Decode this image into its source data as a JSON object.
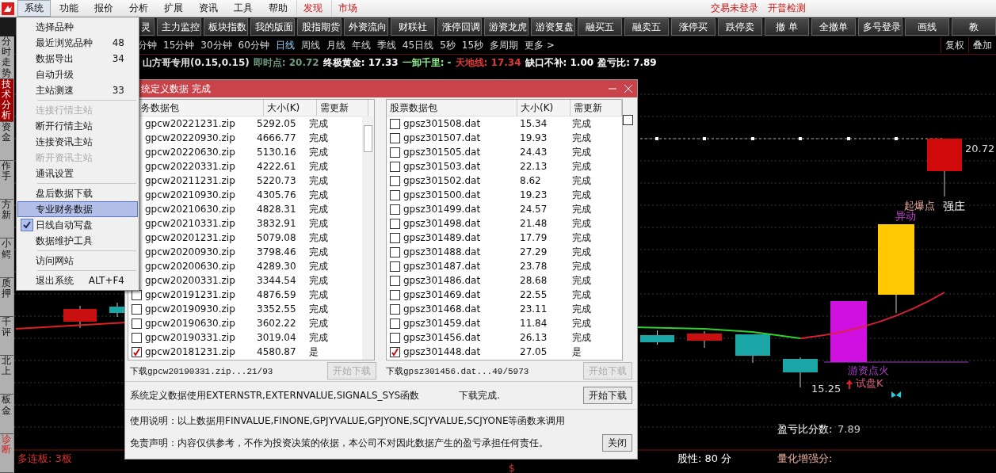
{
  "menubar": {
    "items": [
      {
        "label": "系统",
        "selected": true
      },
      {
        "label": "功能",
        "selected": false
      },
      {
        "label": "报价",
        "selected": false
      },
      {
        "label": "分析",
        "selected": false
      },
      {
        "label": "扩展",
        "selected": false
      },
      {
        "label": "资讯",
        "selected": false
      },
      {
        "label": "工具",
        "selected": false
      },
      {
        "label": "帮助",
        "selected": false
      }
    ],
    "highlights": [
      "发现",
      "市场"
    ],
    "status": [
      "交易未登录",
      "开普检测"
    ]
  },
  "toolbar": {
    "buttons": [
      "灵",
      "主力监控",
      "板块指数",
      "我的版面",
      "股指期货",
      "外资流向",
      "财联社",
      "涨停回调",
      "游资龙虎",
      "游资复盘",
      "融买五",
      "融卖五",
      "涨停买",
      "跌停卖",
      "撤 单",
      "全撤单",
      "多号登录",
      "画线",
      "教"
    ]
  },
  "side_tabs": [
    {
      "label": "分时走势",
      "selected": false,
      "kind": "normal"
    },
    {
      "label": "技术分析",
      "selected": true,
      "kind": "normal"
    },
    {
      "label": "资金",
      "selected": false,
      "kind": "normal"
    },
    {
      "label": "作手",
      "selected": false,
      "kind": "normal"
    },
    {
      "label": "方新",
      "selected": false,
      "kind": "normal"
    },
    {
      "label": "小鳄",
      "selected": false,
      "kind": "normal"
    },
    {
      "label": "质押",
      "selected": false,
      "kind": "normal"
    },
    {
      "label": "千评",
      "selected": false,
      "kind": "normal"
    },
    {
      "label": "北上",
      "selected": false,
      "kind": "normal"
    },
    {
      "label": "板金",
      "selected": false,
      "kind": "normal"
    },
    {
      "label": "诊断",
      "selected": false,
      "kind": "alert"
    }
  ],
  "periods": {
    "items": [
      {
        "label": "分钟",
        "selected": false
      },
      {
        "label": "15分钟",
        "selected": false
      },
      {
        "label": "30分钟",
        "selected": false
      },
      {
        "label": "60分钟",
        "selected": false
      },
      {
        "label": "日线",
        "selected": true
      },
      {
        "label": "周线",
        "selected": false
      },
      {
        "label": "月线",
        "selected": false
      },
      {
        "label": "年线",
        "selected": false
      },
      {
        "label": "季线",
        "selected": false
      },
      {
        "label": "45日线",
        "selected": false
      },
      {
        "label": "5秒",
        "selected": false
      },
      {
        "label": "15秒",
        "selected": false
      },
      {
        "label": "多周期",
        "selected": false
      },
      {
        "label": "更多 >",
        "selected": false
      }
    ],
    "right_buttons": [
      "复权",
      "叠加"
    ]
  },
  "indicator_line": [
    {
      "text": "山方哥专用(0.15,0.15)",
      "color": "#e6e6e6"
    },
    {
      "text": "即时点: 20.72",
      "color": "#6f9a80"
    },
    {
      "text": "终极黄金: 17.33",
      "color": "#ffffff"
    },
    {
      "text": "一卸千里: -",
      "color": "#90ee90"
    },
    {
      "text": "天地线: 17.34",
      "color": "#e03a3a"
    },
    {
      "text": "缺口不补: 1.00",
      "color": "#ffffff"
    },
    {
      "text": "盈亏比: 7.89",
      "color": "#ffffff"
    }
  ],
  "system_menu": {
    "groups": [
      [
        {
          "label": "选择品种",
          "disabled": false,
          "checked": false,
          "selected": false
        },
        {
          "label": "最近浏览品种",
          "shortcut": "48",
          "disabled": false,
          "checked": false,
          "selected": false
        },
        {
          "label": "数据导出",
          "shortcut": "34",
          "disabled": false,
          "checked": false,
          "selected": false
        },
        {
          "label": "自动升级",
          "disabled": false,
          "checked": false,
          "selected": false
        },
        {
          "label": "主站测速",
          "shortcut": "33",
          "disabled": false,
          "checked": false,
          "selected": false
        }
      ],
      [
        {
          "label": "连接行情主站",
          "disabled": true,
          "checked": false,
          "selected": false
        },
        {
          "label": "断开行情主站",
          "disabled": false,
          "checked": false,
          "selected": false
        },
        {
          "label": "连接资讯主站",
          "disabled": false,
          "checked": false,
          "selected": false
        },
        {
          "label": "断开资讯主站",
          "disabled": true,
          "checked": false,
          "selected": false
        },
        {
          "label": "通讯设置",
          "disabled": false,
          "checked": false,
          "selected": false
        }
      ],
      [
        {
          "label": "盘后数据下载",
          "disabled": false,
          "checked": false,
          "selected": false
        },
        {
          "label": "专业财务数据",
          "disabled": false,
          "checked": false,
          "selected": true
        },
        {
          "label": "日线自动写盘",
          "disabled": false,
          "checked": true,
          "selected": false
        },
        {
          "label": "数据维护工具",
          "disabled": false,
          "checked": false,
          "selected": false
        }
      ],
      [
        {
          "label": "访问网站",
          "disabled": false,
          "checked": false,
          "selected": false
        }
      ],
      [
        {
          "label": "退出系统",
          "shortcut": "ALT+F4",
          "disabled": false,
          "checked": false,
          "selected": false
        }
      ]
    ]
  },
  "dialog": {
    "title": "统定义数据 完成",
    "lists": [
      {
        "columns": [
          "务数据包",
          "大小(K)",
          "需更新"
        ],
        "rows": [
          {
            "name": "gpcw20221231.zip",
            "size": "5292.05",
            "status": "完成"
          },
          {
            "name": "gpcw20220930.zip",
            "size": "4666.77",
            "status": "完成"
          },
          {
            "name": "gpcw20220630.zip",
            "size": "5130.16",
            "status": "完成"
          },
          {
            "name": "gpcw20220331.zip",
            "size": "4222.61",
            "status": "完成"
          },
          {
            "name": "gpcw20211231.zip",
            "size": "5220.73",
            "status": "完成"
          },
          {
            "name": "gpcw20210930.zip",
            "size": "4305.76",
            "status": "完成"
          },
          {
            "name": "gpcw20210630.zip",
            "size": "4828.31",
            "status": "完成"
          },
          {
            "name": "gpcw20210331.zip",
            "size": "3832.91",
            "status": "完成"
          },
          {
            "name": "gpcw20201231.zip",
            "size": "5079.08",
            "status": "完成"
          },
          {
            "name": "gpcw20200930.zip",
            "size": "3798.46",
            "status": "完成"
          },
          {
            "name": "gpcw20200630.zip",
            "size": "4289.30",
            "status": "完成"
          },
          {
            "name": "gpcw20200331.zip",
            "size": "3344.54",
            "status": "完成"
          },
          {
            "name": "gpcw20191231.zip",
            "size": "4876.59",
            "status": "完成",
            "checked": false
          },
          {
            "name": "gpcw20190930.zip",
            "size": "3352.55",
            "status": "完成",
            "checked": false
          },
          {
            "name": "gpcw20190630.zip",
            "size": "3602.22",
            "status": "完成",
            "checked": false
          },
          {
            "name": "gpcw20190331.zip",
            "size": "3019.04",
            "status": "完成",
            "checked": false
          },
          {
            "name": "gpcw20181231.zip",
            "size": "4580.87",
            "status": "是",
            "checked": true
          }
        ],
        "progress": "下载gpcw20190331.zip...21/93",
        "button": {
          "label": "开始下载",
          "disabled": true
        }
      },
      {
        "columns": [
          "股票数据包",
          "大小(K)",
          "需更新"
        ],
        "rows": [
          {
            "name": "gpsz301508.dat",
            "size": "15.34",
            "status": "完成",
            "checked": false
          },
          {
            "name": "gpsz301507.dat",
            "size": "19.93",
            "status": "完成",
            "checked": false
          },
          {
            "name": "gpsz301505.dat",
            "size": "24.43",
            "status": "完成",
            "checked": false
          },
          {
            "name": "gpsz301503.dat",
            "size": "22.13",
            "status": "完成",
            "checked": false
          },
          {
            "name": "gpsz301502.dat",
            "size": "8.62",
            "status": "完成",
            "checked": false
          },
          {
            "name": "gpsz301500.dat",
            "size": "19.23",
            "status": "完成",
            "checked": false
          },
          {
            "name": "gpsz301499.dat",
            "size": "24.57",
            "status": "完成",
            "checked": false
          },
          {
            "name": "gpsz301498.dat",
            "size": "21.48",
            "status": "完成",
            "checked": false
          },
          {
            "name": "gpsz301489.dat",
            "size": "17.79",
            "status": "完成",
            "checked": false
          },
          {
            "name": "gpsz301488.dat",
            "size": "27.29",
            "status": "完成",
            "checked": false
          },
          {
            "name": "gpsz301487.dat",
            "size": "23.78",
            "status": "完成",
            "checked": false
          },
          {
            "name": "gpsz301486.dat",
            "size": "28.68",
            "status": "完成",
            "checked": false
          },
          {
            "name": "gpsz301469.dat",
            "size": "22.55",
            "status": "完成",
            "checked": false
          },
          {
            "name": "gpsz301468.dat",
            "size": "23.11",
            "status": "完成",
            "checked": false
          },
          {
            "name": "gpsz301459.dat",
            "size": "11.84",
            "status": "完成",
            "checked": false
          },
          {
            "name": "gpsz301456.dat",
            "size": "26.13",
            "status": "完成",
            "checked": false
          },
          {
            "name": "gpsz301448.dat",
            "size": "27.05",
            "status": "是",
            "checked": true
          }
        ],
        "progress": "下载gpsz301456.dat...49/5973",
        "button": {
          "label": "开始下载",
          "disabled": true
        }
      }
    ],
    "select_all_checked": false,
    "system_note": "系统定义数据使用EXTERNSTR,EXTERNVALUE,SIGNALS_SYS函数",
    "done_text": "下载完成.",
    "start_button": {
      "label": "开始下载",
      "disabled": false
    },
    "usage": "使用说明：以上数据用FINVALUE,FINONE,GPJYVALUE,GPJYONE,SCJYVALUE,SCJYONE等函数来调用",
    "disclaimer": "免责声明：内容仅供参考，不作为投资决策的依据，本公司不对因此数据产生的盈亏承担任何责任。",
    "close_button": "关闭"
  },
  "chart": {
    "high_label": "20.72",
    "low_label": "15.25",
    "breakout": "起爆点",
    "anomaly": "异动",
    "strong": "强庄",
    "ignite": "游资点火",
    "probe": "试盘K",
    "score_ratio_label": "盈亏比分数:",
    "score_ratio_value": "7.89",
    "stock_character": "股性: 80 分",
    "quant_label": "量化增强分:",
    "limit_streak": "多连板: 3板",
    "marker": "$"
  }
}
